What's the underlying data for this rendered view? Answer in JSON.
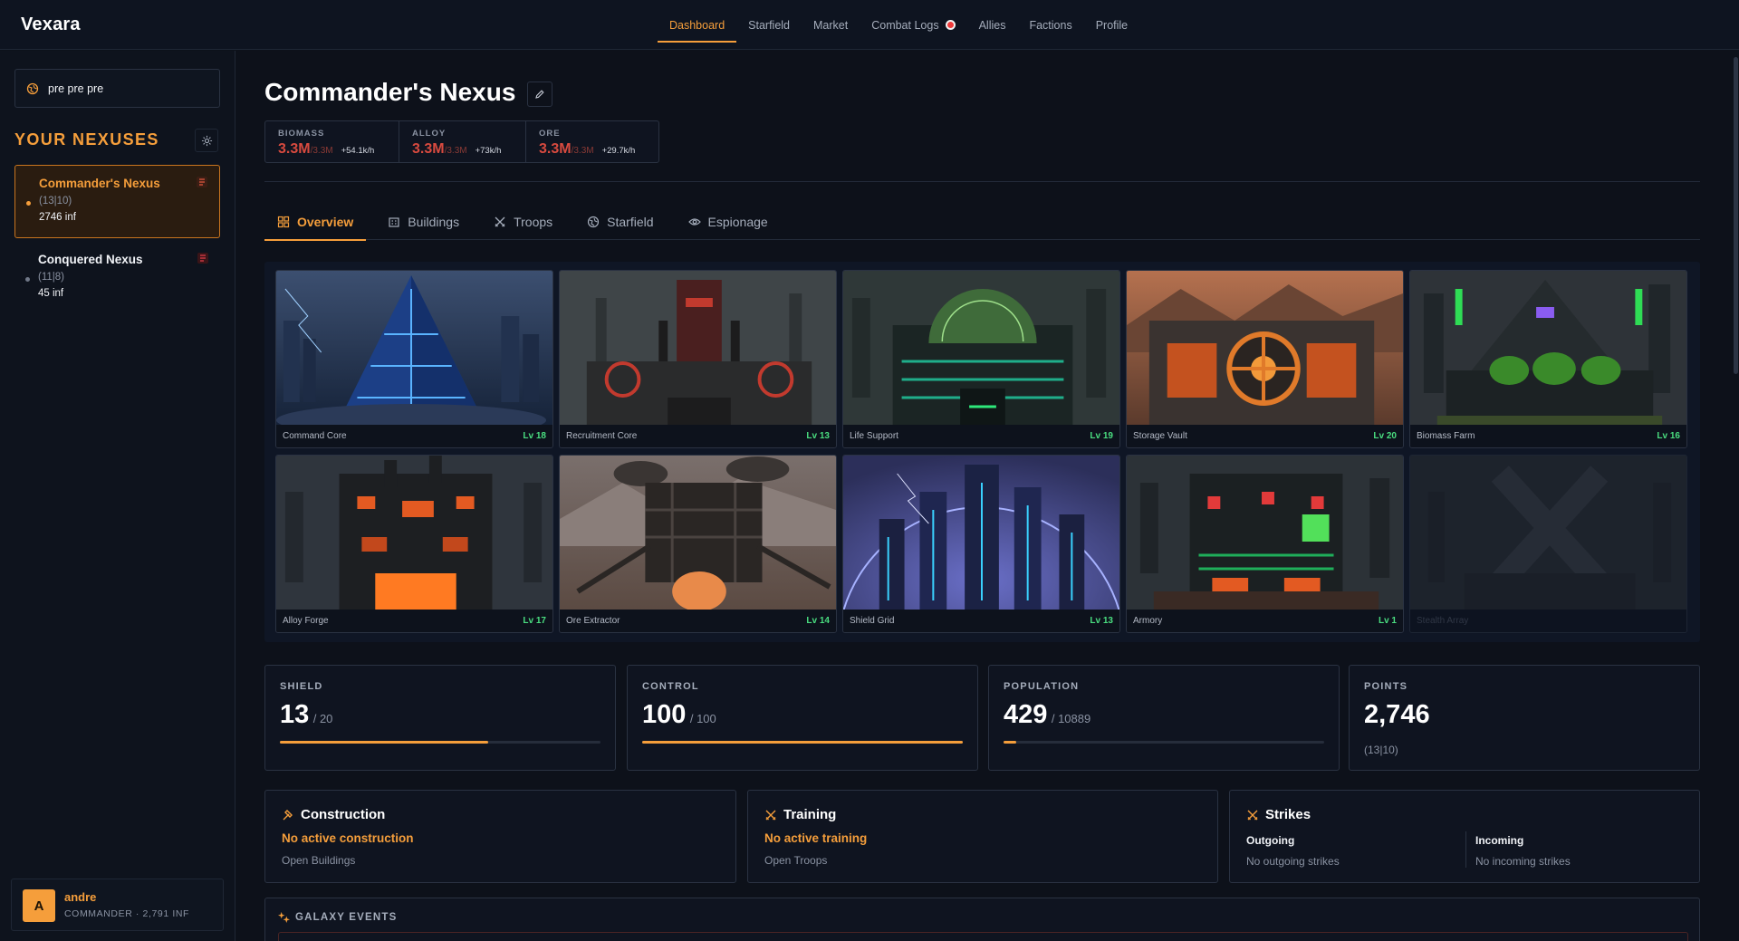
{
  "app": {
    "brand": "Vexara"
  },
  "nav": {
    "items": [
      "Dashboard",
      "Starfield",
      "Market",
      "Combat Logs",
      "Allies",
      "Factions",
      "Profile"
    ],
    "active": "Dashboard",
    "alert_on": "Combat Logs"
  },
  "sidebar": {
    "search_value": "pre pre pre",
    "heading": "YOUR NEXUSES",
    "nexuses": [
      {
        "name": "Commander's Nexus",
        "coords": "(13|10)",
        "influence": "2746 inf",
        "active": true
      },
      {
        "name": "Conquered Nexus",
        "coords": "(11|8)",
        "influence": "45 inf",
        "active": false
      }
    ],
    "user": {
      "initial": "A",
      "name": "andre",
      "subtitle": "COMMANDER · 2,791 INF"
    }
  },
  "main": {
    "title": "Commander's Nexus",
    "resources": [
      {
        "label": "BIOMASS",
        "value": "3.3M",
        "cap": "/3.3M",
        "rate": "+54.1k/h"
      },
      {
        "label": "ALLOY",
        "value": "3.3M",
        "cap": "/3.3M",
        "rate": "+73k/h"
      },
      {
        "label": "ORE",
        "value": "3.3M",
        "cap": "/3.3M",
        "rate": "+29.7k/h"
      }
    ],
    "tabs": [
      "Overview",
      "Buildings",
      "Troops",
      "Starfield",
      "Espionage"
    ],
    "buildings": [
      {
        "name": "Command Core",
        "level": "Lv 18"
      },
      {
        "name": "Recruitment Core",
        "level": "Lv 13"
      },
      {
        "name": "Life Support",
        "level": "Lv 19"
      },
      {
        "name": "Storage Vault",
        "level": "Lv 20"
      },
      {
        "name": "Biomass Farm",
        "level": "Lv 16"
      },
      {
        "name": "Alloy Forge",
        "level": "Lv 17"
      },
      {
        "name": "Ore Extractor",
        "level": "Lv 14"
      },
      {
        "name": "Shield Grid",
        "level": "Lv 13"
      },
      {
        "name": "Armory",
        "level": "Lv 1"
      },
      {
        "name": "Stealth Array",
        "level": ""
      }
    ],
    "stats": [
      {
        "label": "SHIELD",
        "value": "13",
        "max": "/ 20",
        "fraction": 0.65
      },
      {
        "label": "CONTROL",
        "value": "100",
        "max": "/ 100",
        "fraction": 1.0
      },
      {
        "label": "POPULATION",
        "value": "429",
        "max": "/ 10889",
        "fraction": 0.04
      },
      {
        "label": "POINTS",
        "value": "2,746",
        "sub": "(13|10)"
      }
    ],
    "construction": {
      "title": "Construction",
      "status": "No active construction",
      "link": "Open Buildings"
    },
    "training": {
      "title": "Training",
      "status": "No active training",
      "link": "Open Troops"
    },
    "strikes": {
      "title": "Strikes",
      "outgoing_label": "Outgoing",
      "outgoing_text": "No outgoing strikes",
      "incoming_label": "Incoming",
      "incoming_text": "No incoming strikes"
    },
    "galaxy_events": {
      "title": "GALAXY EVENTS"
    }
  },
  "colors": {
    "accent": "#f59e3b",
    "level_green": "#4ade80",
    "resource_red": "#d84a3f",
    "background": "#0d111a"
  }
}
